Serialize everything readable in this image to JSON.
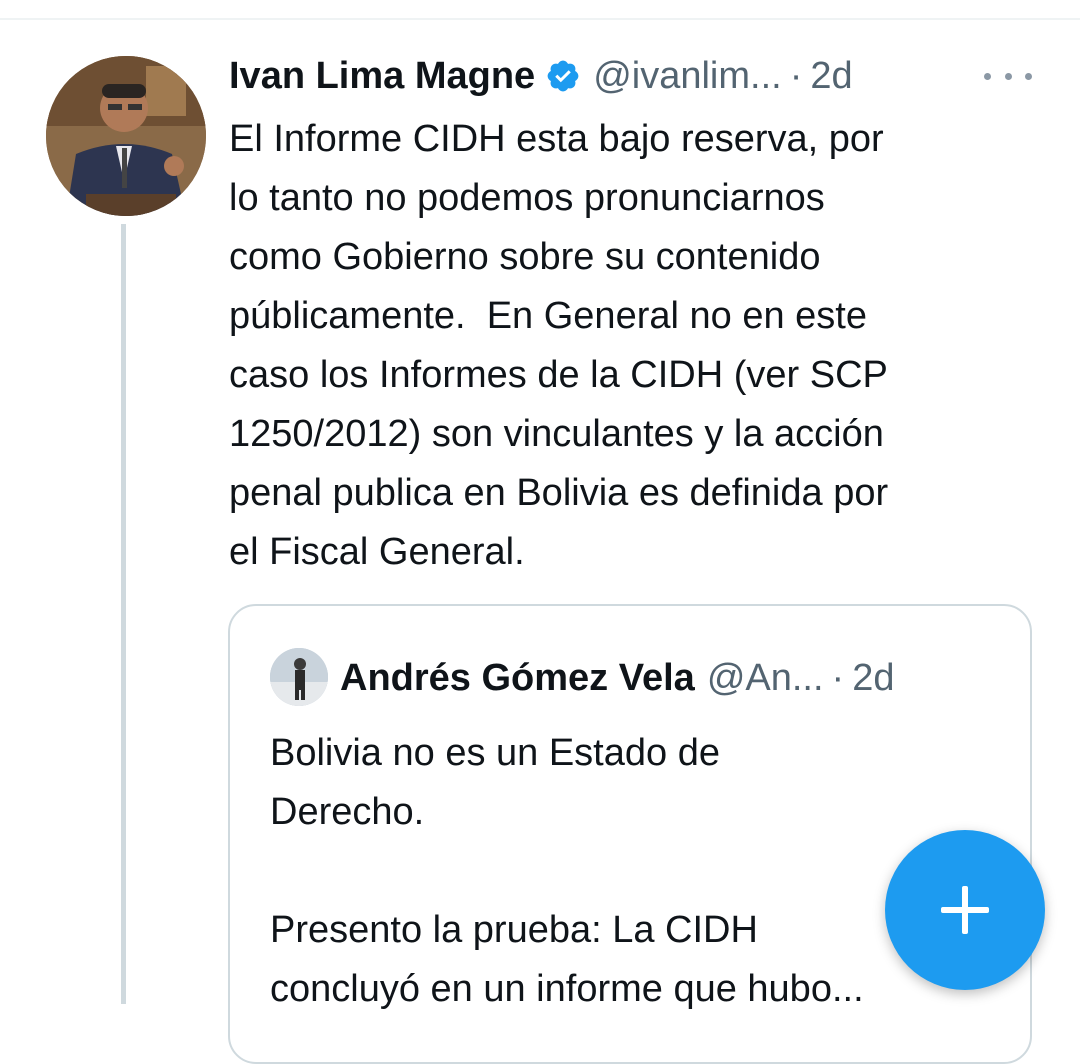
{
  "tweet": {
    "author_name": "Ivan Lima Magne",
    "verified": true,
    "handle": "@ivanlim...",
    "separator": "·",
    "time": "2d",
    "text_lines": [
      "El Informe CIDH esta bajo reserva, por",
      "lo tanto no podemos pronunciarnos",
      "como Gobierno sobre su contenido",
      "públicamente.  En General no en este",
      "caso los Informes de la CIDH (ver SCP",
      "1250/2012) son vinculantes y la acción",
      "penal publica en Bolivia es definida por",
      "el Fiscal General."
    ]
  },
  "quoted_tweet": {
    "author_name": "Andrés Gómez Vela",
    "handle": "@An...",
    "separator": "·",
    "time": "2d",
    "text_lines": [
      "Bolivia no es un Estado de",
      "Derecho.",
      "",
      "Presento la prueba: La CIDH",
      "concluyó en un informe que hubo..."
    ]
  },
  "icons": {
    "verified": "verified-badge-icon",
    "more": "more-options-icon",
    "compose": "plus-icon"
  },
  "colors": {
    "accent": "#1d9bf0",
    "text": "#0f1419",
    "secondary": "#536471",
    "border": "#cfd9de"
  }
}
